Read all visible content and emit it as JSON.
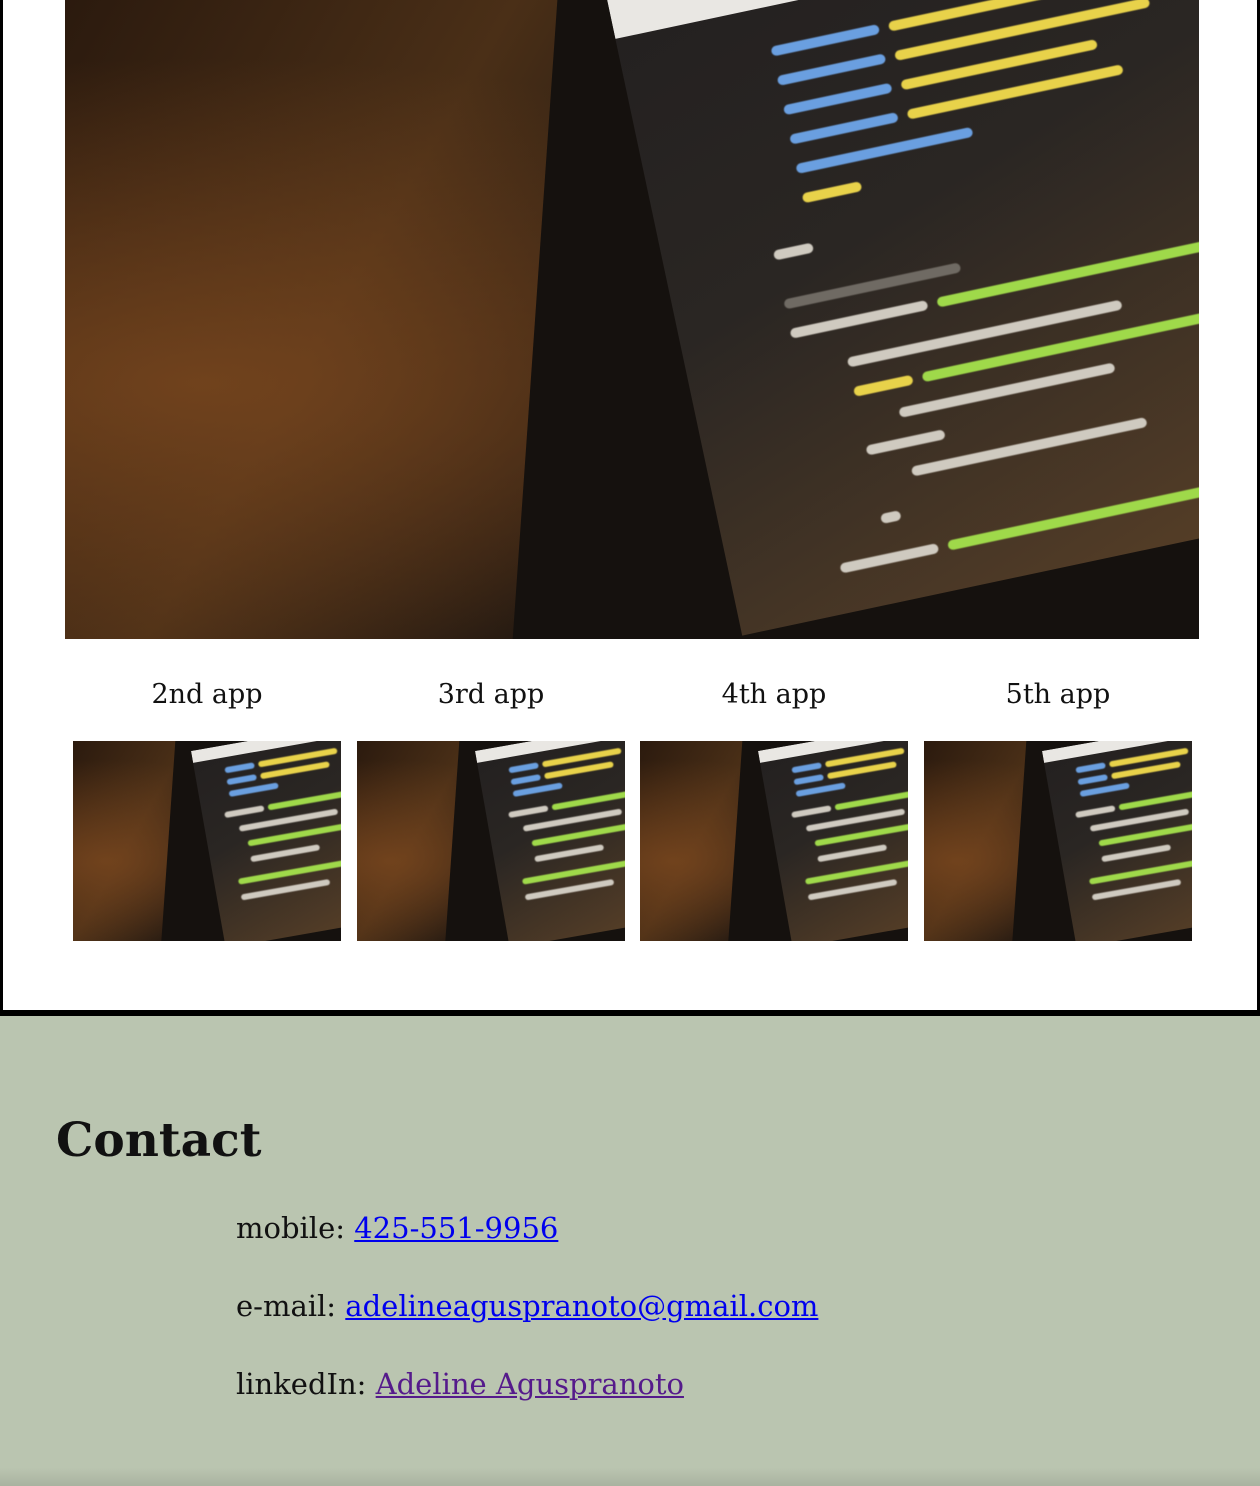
{
  "apps": [
    {
      "label": "2nd app"
    },
    {
      "label": "3rd app"
    },
    {
      "label": "4th app"
    },
    {
      "label": "5th app"
    }
  ],
  "contact": {
    "title": "Contact",
    "mobile_label": "mobile: ",
    "mobile_value": "425-551-9956",
    "email_label": "e-mail: ",
    "email_value": "adelineaguspranoto@gmail.com",
    "linkedin_label": "linkedIn: ",
    "linkedin_value": "Adeline Aguspranoto"
  },
  "colors": {
    "footer_bg": "#bac5b0",
    "link": "#0000ee",
    "visited_link": "#551a8b"
  }
}
